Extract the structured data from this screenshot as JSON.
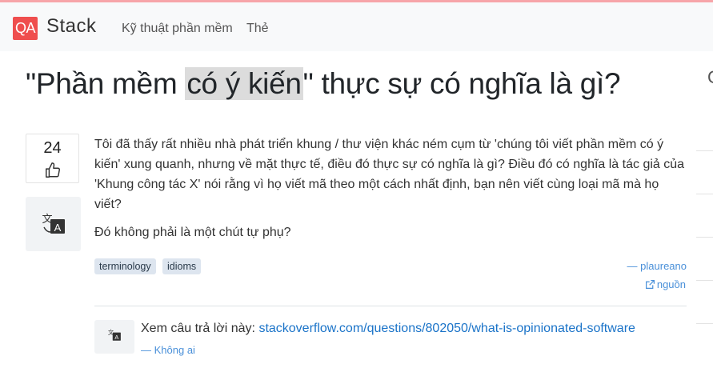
{
  "header": {
    "logo_badge": "QA",
    "logo_text": "Stack",
    "nav": [
      "Kỹ thuật phần mềm",
      "Thẻ"
    ]
  },
  "question": {
    "title_before": "\"Phần mềm ",
    "title_highlight": "có ý kiến",
    "title_after": "\" thực sự có nghĩa là gì?",
    "votes": "24",
    "body": [
      "Tôi đã thấy rất nhiều nhà phát triển khung / thư viện khác ném cụm từ 'chúng tôi viết phần mềm có ý kiến' xung quanh, nhưng về mặt thực tế, điều đó thực sự có nghĩa là gì? Điều đó có nghĩa là tác giả của 'Khung công tác X' nói rằng vì họ viết mã theo một cách nhất định, bạn nên viết cùng loại mã mà họ viết?",
      "Đó không phải là một chút tự phụ?"
    ],
    "tags": [
      "terminology",
      "idioms"
    ],
    "author": "— plaureano",
    "source_label": "nguồn"
  },
  "answer": {
    "prefix": "Xem câu trả lời này: ",
    "link_text": "stackoverflow.com/questions/802050/what-is-opinionated-software",
    "author": "— Không ai"
  },
  "colors": {
    "logo_bg": "#ef4e4e",
    "link": "#1a73c8",
    "tag_bg": "#dde5ef",
    "highlight": "#dcdcdc"
  },
  "icons": [
    "thumbs-up-icon",
    "translate-icon",
    "external-link-icon"
  ]
}
